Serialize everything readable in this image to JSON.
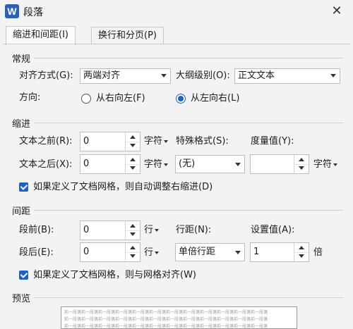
{
  "window": {
    "title": "段落",
    "app_icon_letter": "W",
    "close": "✕"
  },
  "tabs": [
    {
      "label": "缩进和间距(I)"
    },
    {
      "label": "换行和分页(P)"
    }
  ],
  "general": {
    "heading": "常规",
    "alignment_label": "对齐方式(G):",
    "alignment_value": "两端对齐",
    "outline_label": "大纲级别(O):",
    "outline_value": "正文文本",
    "direction_label": "方向:",
    "rtl_label": "从右向左(F)",
    "ltr_label": "从左向右(L)"
  },
  "indent": {
    "heading": "缩进",
    "before_label": "文本之前(R):",
    "before_value": "0",
    "before_unit": "字符",
    "after_label": "文本之后(X):",
    "after_value": "0",
    "after_unit": "字符",
    "special_label": "特殊格式(S):",
    "special_value": "(无)",
    "measure_label": "度量值(Y):",
    "measure_value": "",
    "measure_unit": "字符",
    "auto_adjust_label": "如果定义了文档网格，则自动调整右缩进(D)"
  },
  "spacing": {
    "heading": "间距",
    "before_label": "段前(B):",
    "before_value": "0",
    "before_unit": "行",
    "after_label": "段后(E):",
    "after_value": "0",
    "after_unit": "行",
    "line_label": "行距(N):",
    "line_value": "单倍行距",
    "setting_label": "设置值(A):",
    "setting_value": "1",
    "setting_unit": "倍",
    "grid_align_label": "如果定义了文档网格，则与网格对齐(W)"
  },
  "preview": {
    "heading": "预览",
    "sample_line": "前一段落前一段落前一段落前一段落前一段落前一段落前一段落前一段落前一段落前一段落前一段落前一段落"
  }
}
